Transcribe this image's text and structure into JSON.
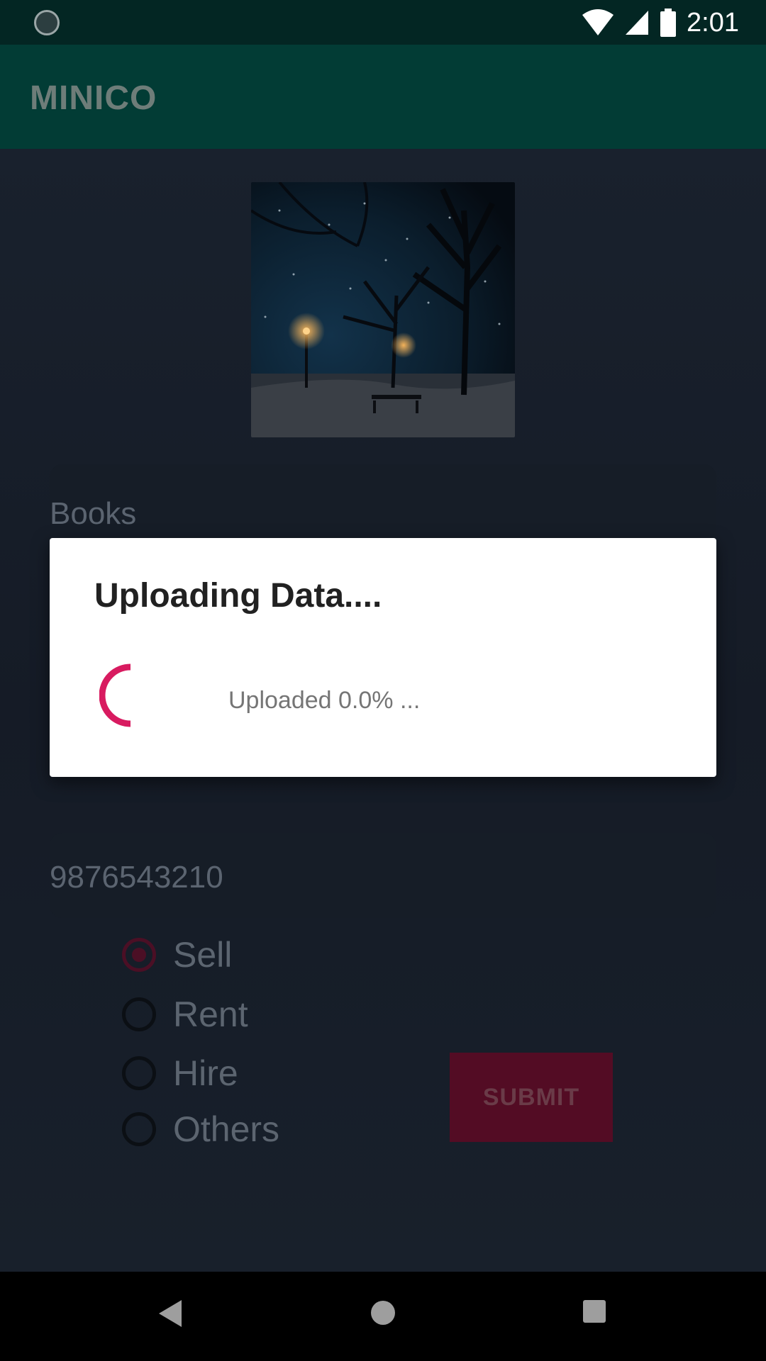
{
  "status_bar": {
    "time": "2:01"
  },
  "app_bar": {
    "title": "MINICO"
  },
  "form": {
    "category_value": "Books",
    "phone_value": "9876543210",
    "options": [
      {
        "label": "Sell",
        "checked": true
      },
      {
        "label": "Rent",
        "checked": false
      },
      {
        "label": "Hire",
        "checked": false
      },
      {
        "label": "Others",
        "checked": false
      }
    ],
    "submit_label": "SUBMIT"
  },
  "dialog": {
    "title": "Uploading Data....",
    "message": "Uploaded 0.0% ...",
    "progress": 0.0
  },
  "colors": {
    "status_bar": "#032623",
    "app_bar": "#023c35",
    "accent": "#d81b60",
    "submit_dimmed": "#530c24"
  },
  "icons": {
    "status_left": "sync-icon",
    "wifi": "wifi-icon",
    "signal": "signal-icon",
    "battery": "battery-icon",
    "nav_back": "back-icon",
    "nav_home": "home-icon",
    "nav_recents": "recents-icon"
  }
}
